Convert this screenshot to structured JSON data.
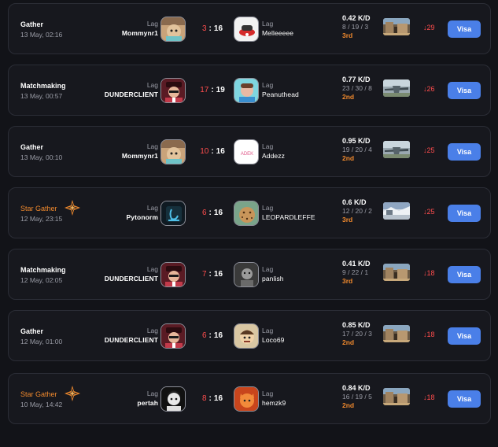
{
  "team_label": "Lag",
  "matches": [
    {
      "mode": "Gather",
      "star": false,
      "date": "13 May, 02:16",
      "my_player": "Mommynr1",
      "my_score": "3",
      "opp_score": "16",
      "opp_player": "Melleeeee",
      "kd": "0.42 K/D",
      "kda": "8 / 19 / 3",
      "place": "3rd",
      "elo": "↓29",
      "action": "Visa",
      "map": "dust",
      "my_avatar": "cat",
      "opp_avatar": "white"
    },
    {
      "mode": "Matchmaking",
      "star": false,
      "date": "13 May, 00:57",
      "my_player": "DUNDERCLIENT",
      "my_score": "17",
      "opp_score": "19",
      "opp_player": "Peanuthead",
      "kd": "0.77 K/D",
      "kda": "23 / 30 / 8",
      "place": "2nd",
      "elo": "↓26",
      "action": "Visa",
      "map": "plane",
      "my_avatar": "red",
      "opp_avatar": "cyan"
    },
    {
      "mode": "Gather",
      "star": false,
      "date": "13 May, 00:10",
      "my_player": "Mommynr1",
      "my_score": "10",
      "opp_score": "16",
      "opp_player": "Addezz",
      "kd": "0.95 K/D",
      "kda": "19 / 20 / 4",
      "place": "2nd",
      "elo": "↓25",
      "action": "Visa",
      "map": "plane",
      "my_avatar": "cat",
      "opp_avatar": "logo"
    },
    {
      "mode": "Star Gather",
      "star": true,
      "date": "12 May, 23:15",
      "my_player": "Pytonorm",
      "my_score": "6",
      "opp_score": "16",
      "opp_player": "LEOPARDLEFFE",
      "kd": "0.6 K/D",
      "kda": "12 / 20 / 2",
      "place": "3rd",
      "elo": "↓25",
      "action": "Visa",
      "map": "snow",
      "my_avatar": "dark",
      "opp_avatar": "leopard"
    },
    {
      "mode": "Matchmaking",
      "star": false,
      "date": "12 May, 02:05",
      "my_player": "DUNDERCLIENT",
      "my_score": "7",
      "opp_score": "16",
      "opp_player": "panlish",
      "kd": "0.41 K/D",
      "kda": "9 / 22 / 1",
      "place": "3rd",
      "elo": "↓18",
      "action": "Visa",
      "map": "dust",
      "my_avatar": "red",
      "opp_avatar": "gray"
    },
    {
      "mode": "Gather",
      "star": false,
      "date": "12 May, 01:00",
      "my_player": "DUNDERCLIENT",
      "my_score": "6",
      "opp_score": "16",
      "opp_player": "Loco69",
      "kd": "0.85 K/D",
      "kda": "17 / 20 / 3",
      "place": "2nd",
      "elo": "↓18",
      "action": "Visa",
      "map": "dust",
      "my_avatar": "red",
      "opp_avatar": "tan"
    },
    {
      "mode": "Star Gather",
      "star": true,
      "date": "10 May, 14:42",
      "my_player": "pertah",
      "my_score": "8",
      "opp_score": "16",
      "opp_player": "hemzk9",
      "kd": "0.84 K/D",
      "kda": "16 / 19 / 5",
      "place": "2nd",
      "elo": "↓18",
      "action": "Visa",
      "map": "dust",
      "my_avatar": "bw",
      "opp_avatar": "orange"
    }
  ]
}
